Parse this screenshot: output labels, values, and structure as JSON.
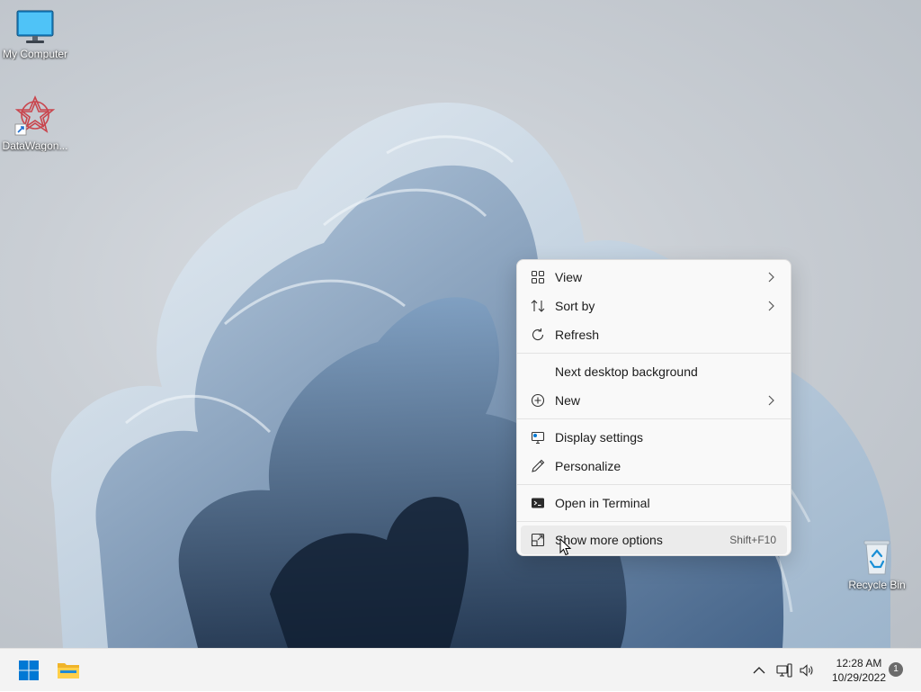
{
  "desktop": {
    "icons": [
      {
        "label": "My Computer",
        "icon": "monitor-icon"
      },
      {
        "label": "DataWagon...",
        "icon": "datawagon-shortcut-icon"
      },
      {
        "label": "Recycle Bin",
        "icon": "recycle-bin-icon"
      }
    ]
  },
  "context_menu": {
    "items": [
      {
        "label": "View",
        "icon": "grid-icon",
        "submenu": true
      },
      {
        "label": "Sort by",
        "icon": "sort-icon",
        "submenu": true
      },
      {
        "label": "Refresh",
        "icon": "refresh-icon",
        "submenu": false
      },
      {
        "label": "Next desktop background",
        "icon": "",
        "submenu": false
      },
      {
        "label": "New",
        "icon": "plus-circle-icon",
        "submenu": true
      },
      {
        "label": "Display settings",
        "icon": "display-settings-icon",
        "submenu": false
      },
      {
        "label": "Personalize",
        "icon": "pen-icon",
        "submenu": false
      },
      {
        "label": "Open in Terminal",
        "icon": "terminal-icon",
        "submenu": false
      },
      {
        "label": "Show more options",
        "icon": "expand-icon",
        "shortcut": "Shift+F10",
        "highlighted": true
      }
    ]
  },
  "taskbar": {
    "start_icon": "windows-start-icon",
    "pinned": [
      "file-explorer-icon"
    ],
    "tray": [
      "chevron-up-icon",
      "network-icon",
      "volume-icon"
    ],
    "time": "12:28 AM",
    "date": "10/29/2022",
    "notification_count": "1"
  },
  "colors": {
    "accent": "#0078d4",
    "menu_bg": "#f9f9f9",
    "taskbar_bg": "#f3f3f3"
  }
}
